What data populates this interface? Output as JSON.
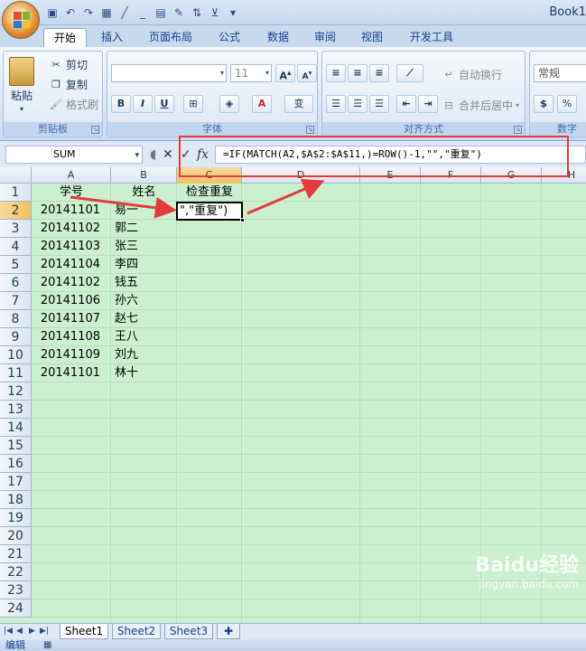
{
  "window": {
    "title": "Book1"
  },
  "ribbon": {
    "tabs": [
      "开始",
      "插入",
      "页面布局",
      "公式",
      "数据",
      "审阅",
      "视图",
      "开发工具"
    ],
    "active_tab": "开始",
    "clipboard": {
      "paste": "粘贴",
      "cut": "剪切",
      "copy": "复制",
      "format_painter": "格式刷",
      "label": "剪贴板"
    },
    "font": {
      "name": "",
      "size": "11",
      "label": "字体",
      "bold": "B",
      "italic": "I",
      "underline": "U"
    },
    "alignment": {
      "wrap": "自动换行",
      "merge": "合并后居中",
      "label": "对齐方式"
    },
    "number": {
      "format": "常规",
      "percent": "%",
      "label": "数字"
    }
  },
  "formula_bar": {
    "name_box": "SUM",
    "cancel": "✕",
    "enter": "✓",
    "fx": "fx",
    "formula": "=IF(MATCH(A2,$A$2:$A$11,)=ROW()-1,\"\",\"重复\")"
  },
  "grid": {
    "columns": [
      "A",
      "B",
      "C",
      "D",
      "E",
      "F",
      "G",
      "H"
    ],
    "selected_column": "C",
    "rows": [
      "1",
      "2",
      "3",
      "4",
      "5",
      "6",
      "7",
      "8",
      "9",
      "10",
      "11",
      "12",
      "13",
      "14",
      "15",
      "16",
      "17",
      "18",
      "19",
      "20",
      "21",
      "22",
      "23",
      "24"
    ],
    "selected_row": "2",
    "headers": {
      "a": "学号",
      "b": "姓名",
      "c": "检查重复"
    },
    "data": [
      {
        "id": "20141101",
        "name": "易一"
      },
      {
        "id": "20141102",
        "name": "郭二"
      },
      {
        "id": "20141103",
        "name": "张三"
      },
      {
        "id": "20141104",
        "name": "李四"
      },
      {
        "id": "20141102",
        "name": "钱五"
      },
      {
        "id": "20141106",
        "name": "孙六"
      },
      {
        "id": "20141107",
        "name": "赵七"
      },
      {
        "id": "20141108",
        "name": "王八"
      },
      {
        "id": "20141109",
        "name": "刘九"
      },
      {
        "id": "20141101",
        "name": "林十"
      }
    ],
    "active_cell_text": "\",\"重复\")"
  },
  "sheets": [
    "Sheet1",
    "Sheet2",
    "Sheet3"
  ],
  "active_sheet": "Sheet1",
  "status": {
    "mode": "编辑"
  },
  "watermark": {
    "logo": "Baidu经验",
    "url": "jingyan.baidu.com"
  },
  "colors": {
    "grid_bg": "#ccf0cf",
    "annotation_red": "#e53a3a",
    "selected_header": "#f1c15f"
  }
}
